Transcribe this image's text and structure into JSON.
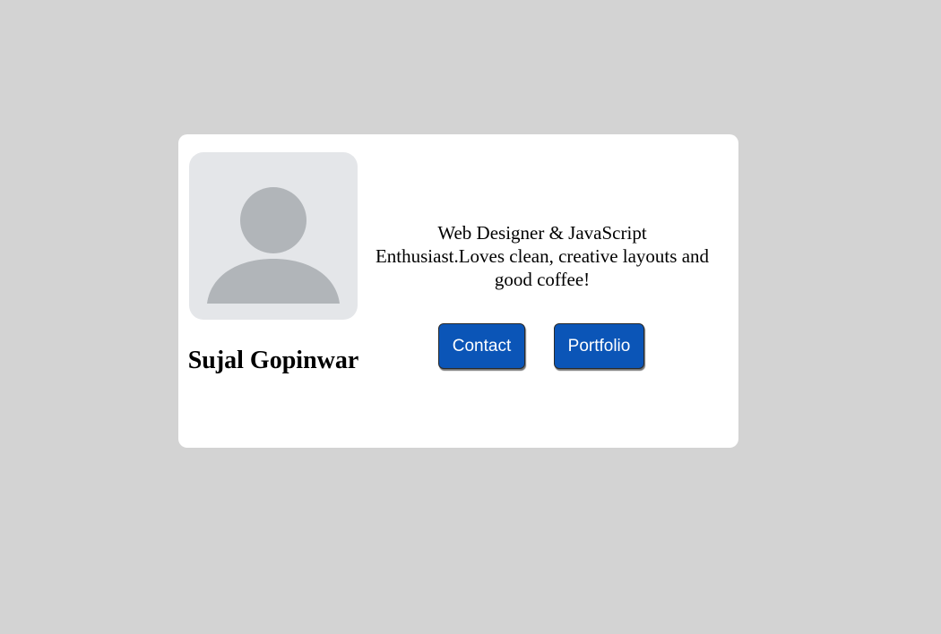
{
  "profile": {
    "name": "Sujal Gopinwar",
    "bio": "Web Designer & JavaScript Enthusiast.Loves clean, creative layouts and good coffee!",
    "avatar_icon": "user-silhouette-icon"
  },
  "actions": {
    "contact_label": "Contact",
    "portfolio_label": "Portfolio"
  },
  "colors": {
    "page_background": "#d3d3d3",
    "card_background": "#ffffff",
    "avatar_background": "#e4e6e9",
    "avatar_silhouette": "#b1b5b9",
    "button_background": "#0b55b7",
    "button_text": "#ffffff"
  }
}
